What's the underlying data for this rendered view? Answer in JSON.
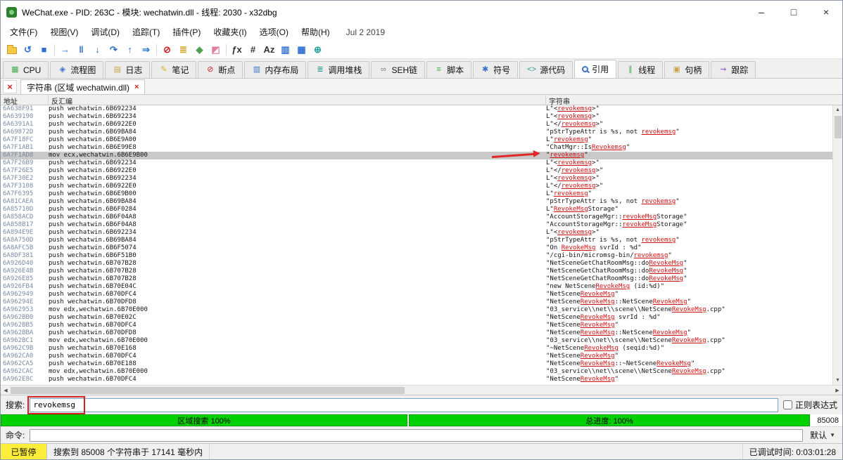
{
  "window": {
    "title": "WeChat.exe - PID: 263C - 模块: wechatwin.dll - 线程: 2030 - x32dbg",
    "controls": {
      "minimize": "–",
      "maximize": "□",
      "close": "×"
    }
  },
  "colors": {
    "progress_green": "#00cf00",
    "paused_yellow": "#fdee3c",
    "match_red": "#d01010",
    "annotation_red": "#e02828",
    "selection_gray": "#c9c9c9",
    "address_gray": "#7c8ba3"
  },
  "menu": {
    "items": [
      {
        "id": "file",
        "label": "文件(F)"
      },
      {
        "id": "view",
        "label": "视图(V)"
      },
      {
        "id": "debug",
        "label": "调试(D)"
      },
      {
        "id": "trace",
        "label": "追踪(T)"
      },
      {
        "id": "plugins",
        "label": "插件(P)"
      },
      {
        "id": "favourites",
        "label": "收藏夹(I)"
      },
      {
        "id": "options",
        "label": "选项(O)"
      },
      {
        "id": "help",
        "label": "帮助(H)"
      }
    ],
    "build_date": "Jul 2 2019"
  },
  "toolbar": {
    "icons": [
      {
        "name": "open-file-icon",
        "glyph": "FOLDER",
        "color": "#f0c040"
      },
      {
        "name": "restart-icon",
        "glyph": "↺",
        "color": "#2f6fd0"
      },
      {
        "name": "stop-icon",
        "glyph": "■",
        "color": "#2f6fd0"
      },
      {
        "name": "separator",
        "glyph": "SEP",
        "color": ""
      },
      {
        "name": "run-icon",
        "glyph": "→",
        "color": "#2f6fd0"
      },
      {
        "name": "pause-icon",
        "glyph": "‖",
        "color": "#2f6fd0"
      },
      {
        "name": "step-into-icon",
        "glyph": "↓",
        "color": "#2f6fd0"
      },
      {
        "name": "step-over-icon",
        "glyph": "↷",
        "color": "#2f6fd0"
      },
      {
        "name": "step-out-icon",
        "glyph": "↑",
        "color": "#2f6fd0"
      },
      {
        "name": "run-to-user-code-icon",
        "glyph": "⇒",
        "color": "#2f6fd0"
      },
      {
        "name": "separator",
        "glyph": "SEP",
        "color": ""
      },
      {
        "name": "breakpoint-icon",
        "glyph": "⊘",
        "color": "#d02020"
      },
      {
        "name": "memory-map-icon",
        "glyph": "≣",
        "color": "#d0a020"
      },
      {
        "name": "patch-icon",
        "glyph": "◆",
        "color": "#50a050"
      },
      {
        "name": "eraser-icon",
        "glyph": "◩",
        "color": "#e080a0"
      },
      {
        "name": "separator",
        "glyph": "SEP",
        "color": ""
      },
      {
        "name": "fx-icon",
        "glyph": "ƒx",
        "color": "#333333"
      },
      {
        "name": "hash-icon",
        "glyph": "#",
        "color": "#333333"
      },
      {
        "name": "az-icon",
        "glyph": "Az",
        "color": "#333333"
      },
      {
        "name": "memory-columns-icon",
        "glyph": "▥",
        "color": "#2f6fd0"
      },
      {
        "name": "table-icon",
        "glyph": "▦",
        "color": "#2f6fd0"
      },
      {
        "name": "globe-icon",
        "glyph": "⊕",
        "color": "#1f9f9f"
      }
    ]
  },
  "tabs": [
    {
      "id": "cpu",
      "label": "CPU",
      "icon": {
        "name": "cpu-icon",
        "glyph": "▦",
        "color": "#3fae49"
      }
    },
    {
      "id": "graph",
      "label": "流程图",
      "icon": {
        "name": "flow-graph-icon",
        "glyph": "◈",
        "color": "#3a72c8"
      }
    },
    {
      "id": "log",
      "label": "日志",
      "icon": {
        "name": "log-icon",
        "glyph": "▤",
        "color": "#caa34a"
      }
    },
    {
      "id": "notes",
      "label": "笔记",
      "icon": {
        "name": "notes-icon",
        "glyph": "✎",
        "color": "#d8b020"
      }
    },
    {
      "id": "breakpoints",
      "label": "断点",
      "icon": {
        "name": "breakpoint-icon",
        "glyph": "⊘",
        "color": "#d02020"
      }
    },
    {
      "id": "memory-map",
      "label": "内存布局",
      "icon": {
        "name": "memory-map-icon",
        "glyph": "▥",
        "color": "#3a72c8"
      }
    },
    {
      "id": "call-stack",
      "label": "调用堆栈",
      "icon": {
        "name": "call-stack-icon",
        "glyph": "≣",
        "color": "#2a9d8f"
      }
    },
    {
      "id": "seh",
      "label": "SEH链",
      "icon": {
        "name": "seh-chain-icon",
        "glyph": "∞",
        "color": "#6a7a8a"
      }
    },
    {
      "id": "script",
      "label": "脚本",
      "icon": {
        "name": "script-icon",
        "glyph": "≡",
        "color": "#3fae49"
      }
    },
    {
      "id": "symbols",
      "label": "符号",
      "icon": {
        "name": "symbols-icon",
        "glyph": "✱",
        "color": "#3a72c8"
      }
    },
    {
      "id": "source",
      "label": "源代码",
      "icon": {
        "name": "source-code-icon",
        "glyph": "<>",
        "color": "#2a9d8f"
      }
    },
    {
      "id": "references",
      "label": "引用",
      "selected": true,
      "icon": {
        "name": "references-magnifier-icon",
        "glyph": "MAG",
        "color": "#3a72c8"
      }
    },
    {
      "id": "threads",
      "label": "线程",
      "icon": {
        "name": "threads-icon",
        "glyph": "∥",
        "color": "#3fae49"
      }
    },
    {
      "id": "handles",
      "label": "句柄",
      "icon": {
        "name": "handles-icon",
        "glyph": "▣",
        "color": "#caa34a"
      }
    },
    {
      "id": "trace",
      "label": "跟踪",
      "icon": {
        "name": "trace-icon",
        "glyph": "⇝",
        "color": "#8a5ac8"
      }
    }
  ],
  "subtab": {
    "label": "字符串 (区域 wechatwin.dll)",
    "close_glyph": "×"
  },
  "table": {
    "columns": [
      "地址",
      "反汇编",
      "字符串"
    ],
    "search_term": "revokemsg",
    "selected_row": 6,
    "rows": [
      {
        "addr": "6A638F91",
        "disasm": "push wechatwin.6B692234",
        "str": "L\"<revokemsg>\""
      },
      {
        "addr": "6A639190",
        "disasm": "push wechatwin.6B692234",
        "str": "L\"<revokemsg>\""
      },
      {
        "addr": "6A6391A1",
        "disasm": "push wechatwin.6B6922E0",
        "str": "L\"</revokemsg>\""
      },
      {
        "addr": "6A69872D",
        "disasm": "push wechatwin.6B69BA84",
        "str": "\"pStrTypeAttr is %s, not revokemsg\""
      },
      {
        "addr": "6A7F18FC",
        "disasm": "push wechatwin.6B6E9A00",
        "str": "L\"revokemsg\""
      },
      {
        "addr": "6A7F1AB1",
        "disasm": "push wechatwin.6B6E99E8",
        "str": "\"ChatMgr::IsRevokemsg\""
      },
      {
        "addr": "6A7F1AD8",
        "disasm": "mov ecx,wechatwin.6B6E9B00",
        "str": "\"revokemsg\""
      },
      {
        "addr": "6A7F26B9",
        "disasm": "push wechatwin.6B692234",
        "str": "L\"<revokemsg>\""
      },
      {
        "addr": "6A7F26E5",
        "disasm": "push wechatwin.6B6922E0",
        "str": "L\"</revokemsg>\""
      },
      {
        "addr": "6A7F30E2",
        "disasm": "push wechatwin.6B692234",
        "str": "L\"<revokemsg>\""
      },
      {
        "addr": "6A7F3108",
        "disasm": "push wechatwin.6B6922E0",
        "str": "L\"</revokemsg>\""
      },
      {
        "addr": "6A7F6395",
        "disasm": "push wechatwin.6B6E9B00",
        "str": "L\"revokemsg\""
      },
      {
        "addr": "6A81CAEA",
        "disasm": "push wechatwin.6B69BA84",
        "str": "\"pStrTypeAttr is %s, not revokemsg\""
      },
      {
        "addr": "6A85710D",
        "disasm": "push wechatwin.6B6F0284",
        "str": "L\"RevokeMsgStorage\""
      },
      {
        "addr": "6A858ACD",
        "disasm": "push wechatwin.6B6F04A8",
        "str": "\"AccountStorageMgr::revokeMsgStorage\""
      },
      {
        "addr": "6A858B17",
        "disasm": "push wechatwin.6B6F04A8",
        "str": "\"AccountStorageMgr::revokeMsgStorage\""
      },
      {
        "addr": "6A894E9E",
        "disasm": "push wechatwin.6B692234",
        "str": "L\"<revokemsg>\""
      },
      {
        "addr": "6A8A750D",
        "disasm": "push wechatwin.6B69BA84",
        "str": "\"pStrTypeAttr is %s, not revokemsg\""
      },
      {
        "addr": "6A8AFC5B",
        "disasm": "push wechatwin.6B6F5074",
        "str": "\"On RevokeMsg svrId : %d\""
      },
      {
        "addr": "6A8DF381",
        "disasm": "push wechatwin.6B6F51B0",
        "str": "\"/cgi-bin/micromsg-bin/revokemsg\""
      },
      {
        "addr": "6A926D40",
        "disasm": "push wechatwin.6B707B28",
        "str": "\"NetSceneGetChatRoomMsg::doRevokeMsg\""
      },
      {
        "addr": "6A926E4B",
        "disasm": "push wechatwin.6B707B28",
        "str": "\"NetSceneGetChatRoomMsg::doRevokeMsg\""
      },
      {
        "addr": "6A926E85",
        "disasm": "push wechatwin.6B707B28",
        "str": "\"NetSceneGetChatRoomMsg::doRevokeMsg\""
      },
      {
        "addr": "6A926FB4",
        "disasm": "push wechatwin.6B70E04C",
        "str": "\"new NetSceneRevokeMsg (id:%d)\""
      },
      {
        "addr": "6A962949",
        "disasm": "push wechatwin.6B70DFC4",
        "str": "\"NetSceneRevokeMsg\""
      },
      {
        "addr": "6A96294E",
        "disasm": "push wechatwin.6B70DFD8",
        "str": "\"NetSceneRevokeMsg::NetSceneRevokeMsg\""
      },
      {
        "addr": "6A962953",
        "disasm": "mov edx,wechatwin.6B70E000",
        "str": "\"03_service\\\\net\\\\scene\\\\NetSceneRevokeMsg.cpp\""
      },
      {
        "addr": "6A962BB0",
        "disasm": "push wechatwin.6B70E02C",
        "str": "\"NetSceneRevokeMsg svrId : %d\""
      },
      {
        "addr": "6A962BB5",
        "disasm": "push wechatwin.6B70DFC4",
        "str": "\"NetSceneRevokeMsg\""
      },
      {
        "addr": "6A962BBA",
        "disasm": "push wechatwin.6B70DFD8",
        "str": "\"NetSceneRevokeMsg::NetSceneRevokeMsg\""
      },
      {
        "addr": "6A962BC1",
        "disasm": "mov edx,wechatwin.6B70E000",
        "str": "\"03_service\\\\net\\\\scene\\\\NetSceneRevokeMsg.cpp\""
      },
      {
        "addr": "6A962C9B",
        "disasm": "push wechatwin.6B70E168",
        "str": "\"~NetSceneRevokeMsg (seqid:%d)\""
      },
      {
        "addr": "6A962CA0",
        "disasm": "push wechatwin.6B70DFC4",
        "str": "\"NetSceneRevokeMsg\""
      },
      {
        "addr": "6A962CA5",
        "disasm": "push wechatwin.6B70E188",
        "str": "\"NetSceneRevokeMsg::~NetSceneRevokeMsg\""
      },
      {
        "addr": "6A962CAC",
        "disasm": "mov edx,wechatwin.6B70E000",
        "str": "\"03_service\\\\net\\\\scene\\\\NetSceneRevokeMsg.cpp\""
      },
      {
        "addr": "6A962E8C",
        "disasm": "push wechatwin.6B70DFC4",
        "str": "\"NetSceneRevokeMsg\""
      }
    ]
  },
  "search": {
    "label": "搜索:",
    "value": "revokemsg",
    "regex_label": "正则表达式"
  },
  "progress": {
    "region_label": "区域搜索 100%",
    "total_label": "总进度: 100%",
    "count": "85008"
  },
  "command": {
    "label": "命令:",
    "value": "",
    "profile": "默认"
  },
  "status": {
    "state": "已暂停",
    "message": "搜索到 85008 个字符串于 17141 毫秒内",
    "time": "已调试时间: 0:03:01:28"
  }
}
